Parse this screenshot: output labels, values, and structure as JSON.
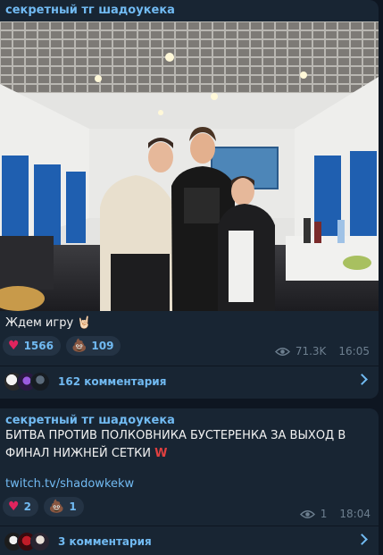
{
  "colors": {
    "background": "#0e1621",
    "bubble": "#182533",
    "accent": "#71baf2",
    "heart": "#e0245e",
    "meta": "#6d7f8f"
  },
  "posts": [
    {
      "channel": "секретный тг шадоукека",
      "text": "Ждем игру 🤘🏻",
      "reactions": [
        {
          "icon": "heart-icon",
          "glyph": "♥",
          "count": "1566"
        },
        {
          "icon": "poop-icon",
          "glyph": "💩",
          "count": "109"
        }
      ],
      "views": "71.3K",
      "time": "16:05",
      "comments_label": "162 комментария"
    },
    {
      "channel": "секретный тг шадоукека",
      "text": "БИТВА ПРОТИВ ПОЛКОВНИКА БУСТЕРЕНКА ЗА ВЫХОД В ФИНАЛ НИЖНЕЙ СЕТКИ",
      "text_mark": "W",
      "link": "twitch.tv/shadowkekw",
      "reactions": [
        {
          "icon": "heart-icon",
          "glyph": "♥",
          "count": "2"
        },
        {
          "icon": "poop-icon",
          "glyph": "💩",
          "count": "1"
        }
      ],
      "views": "1",
      "time": "18:04",
      "comments_label": "3 комментария"
    }
  ]
}
